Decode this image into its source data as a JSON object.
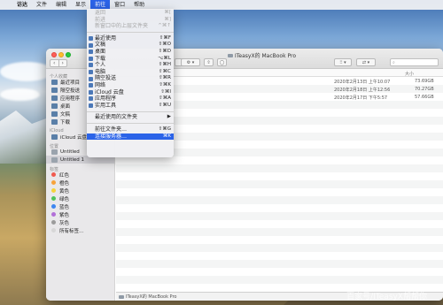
{
  "menubar": {
    "apple": "",
    "items": [
      "访达",
      "文件",
      "编辑",
      "显示",
      "前往",
      "窗口",
      "帮助"
    ]
  },
  "go_menu": {
    "back": {
      "label": "返回",
      "shortcut": "⌘["
    },
    "forward": {
      "label": "前进",
      "shortcut": "⌘]"
    },
    "enclosing": {
      "label": "新窗口中的上层文件夹",
      "shortcut": "^⌘↑"
    },
    "places": [
      {
        "label": "最近使用",
        "shortcut": "⇧⌘F"
      },
      {
        "label": "文稿",
        "shortcut": "⇧⌘O"
      },
      {
        "label": "桌面",
        "shortcut": "⇧⌘D"
      },
      {
        "label": "下载",
        "shortcut": "⌥⌘L"
      },
      {
        "label": "个人",
        "shortcut": "⇧⌘H"
      },
      {
        "label": "电脑",
        "shortcut": "⇧⌘C"
      },
      {
        "label": "隔空投送",
        "shortcut": "⇧⌘R"
      },
      {
        "label": "网络",
        "shortcut": "⇧⌘K"
      },
      {
        "label": "iCloud 云盘",
        "shortcut": "⇧⌘I"
      },
      {
        "label": "应用程序",
        "shortcut": "⇧⌘A"
      },
      {
        "label": "实用工具",
        "shortcut": "⇧⌘U"
      }
    ],
    "recent_folders": {
      "label": "最近使用的文件夹",
      "arrow": "▶"
    },
    "go_to_folder": {
      "label": "前往文件夹…",
      "shortcut": "⇧⌘G"
    },
    "connect_server": {
      "label": "连接服务器…",
      "shortcut": "⌘K"
    }
  },
  "window": {
    "title": "ITeasyX的 MacBook Pro",
    "nav_back": "‹",
    "nav_forward": "›",
    "search_placeholder": "",
    "path": "ITeasyX的 MacBook Pro"
  },
  "sidebar": {
    "favorites_header": "个人收藏",
    "favorites": [
      "最近项目",
      "隔空投送",
      "应用程序",
      "桌面",
      "文稿",
      "下载"
    ],
    "icloud_header": "iCloud",
    "icloud": [
      "iCloud 云盘"
    ],
    "locations_header": "位置",
    "locations": [
      "Untitled",
      "Untitled 1"
    ],
    "tags_header": "标签",
    "tags": [
      {
        "label": "红色",
        "color": "#f05a4f"
      },
      {
        "label": "橙色",
        "color": "#f7a23b"
      },
      {
        "label": "黄色",
        "color": "#f5d33c"
      },
      {
        "label": "绿色",
        "color": "#4fc25a"
      },
      {
        "label": "蓝色",
        "color": "#3d86f0"
      },
      {
        "label": "紫色",
        "color": "#b26fd8"
      },
      {
        "label": "灰色",
        "color": "#9b9b9b"
      },
      {
        "label": "所有标签…",
        "color": "#d7d7d7"
      }
    ]
  },
  "file_list": {
    "headers": {
      "date": "",
      "size": "大小"
    },
    "rows": [
      {
        "date": "2020年2月13日 上午10:07",
        "size": "73.69GB"
      },
      {
        "date": "2020年2月18日 上午12:56",
        "size": "70.27GB"
      },
      {
        "date": "2020年2月17日 下午5:57",
        "size": "57.66GB"
      }
    ]
  },
  "watermark": "百家号/ITeasyX帮帮你"
}
